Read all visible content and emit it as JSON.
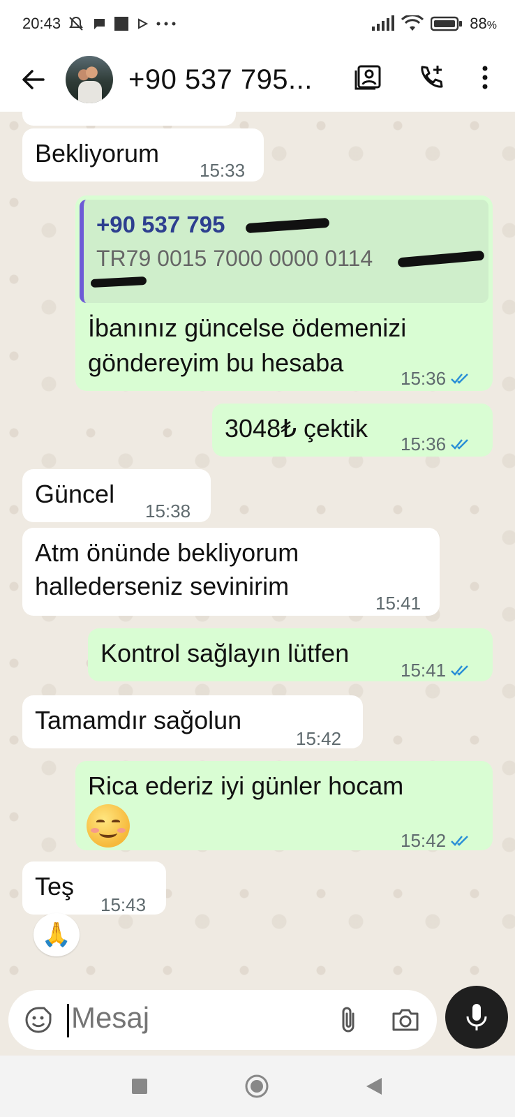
{
  "status_bar": {
    "time": "20:43",
    "battery": "88"
  },
  "header": {
    "contact": "+90 537 795..."
  },
  "messages": [
    {
      "text": "Bekliyorum",
      "time": "15:33"
    },
    {
      "quote_name": "+90 537 795",
      "quote_text": "TR79 0015 7000 0000 0114",
      "line1": "İbanınız güncelse ödemenizi",
      "line2": "göndereyim bu hesaba",
      "time": "15:36"
    },
    {
      "text": "3048₺ çektik",
      "time": "15:36"
    },
    {
      "text": "Güncel",
      "time": "15:38"
    },
    {
      "line1": "Atm önünde bekliyorum",
      "line2": "hallederseniz sevinirim",
      "time": "15:41"
    },
    {
      "text": "Kontrol sağlayın lütfen",
      "time": "15:41"
    },
    {
      "text": "Tamamdır sağolun",
      "time": "15:42"
    },
    {
      "line1": "Rica ederiz iyi günler hocam",
      "time": "15:42"
    },
    {
      "text": "Teş",
      "time": "15:43",
      "reaction": "🙏"
    }
  ],
  "input": {
    "placeholder": "Mesaj"
  },
  "colors": {
    "outgoing": "#d9fdd3",
    "incoming": "#ffffff",
    "tick_blue": "#2a8fd6",
    "quote_bar": "#6d5bd6"
  }
}
